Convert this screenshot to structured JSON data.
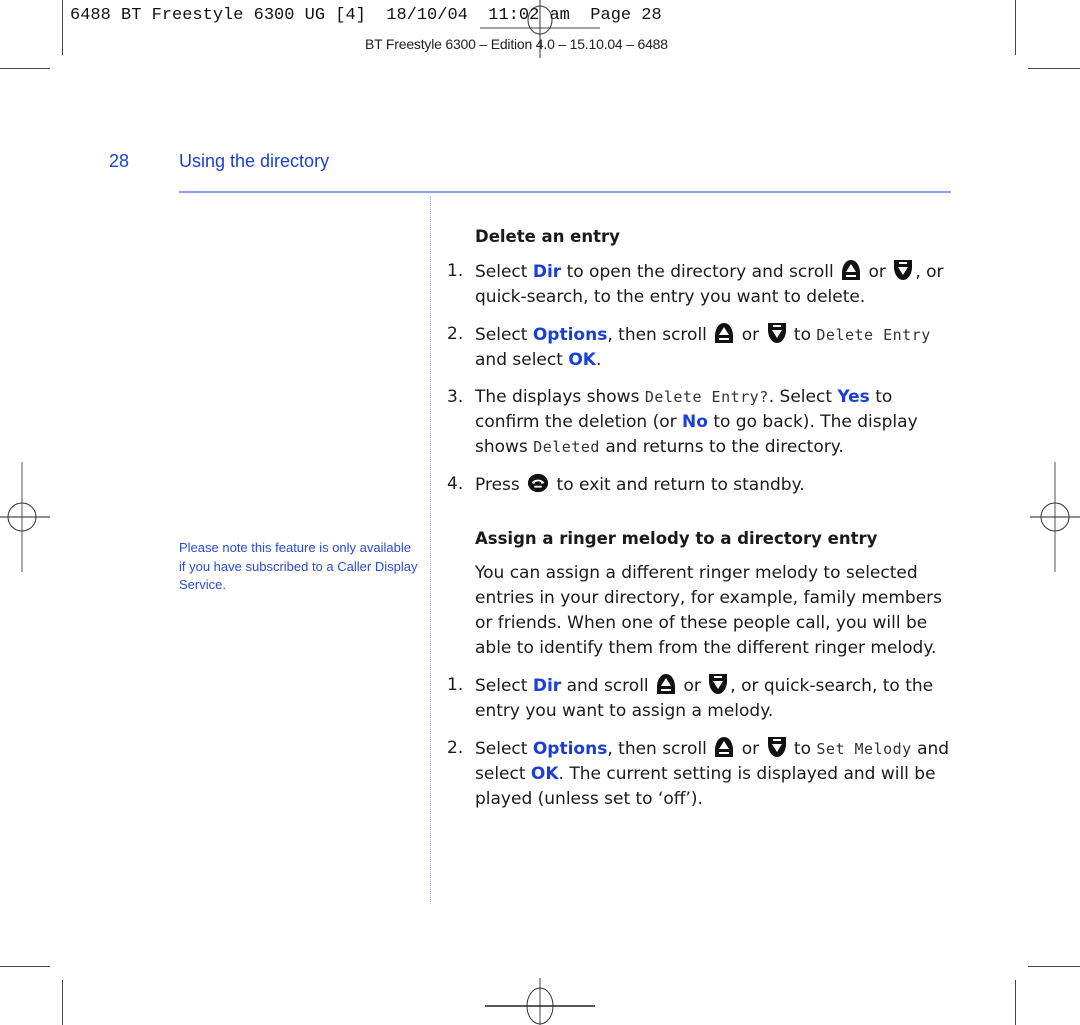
{
  "print_slug": {
    "text": "6488 BT Freestyle 6300 UG [4]  18/10/04  11:02 am  Page 28",
    "edition": "BT Freestyle 6300 – Edition 4.0 – 15.10.04 – 6488"
  },
  "header": {
    "page_number": "28",
    "section_title": "Using the directory"
  },
  "sidebar_note": "Please note this feature is only available if you have subscribed to a Caller Display Service.",
  "icons": {
    "up": "redial-up-key-icon",
    "down": "calls-down-key-icon",
    "end": "end-call-key-icon"
  },
  "delete_section": {
    "heading": "Delete an entry",
    "steps": [
      {
        "num": "1.",
        "t1": "Select ",
        "k1": "Dir",
        "t2": " to open the directory and scroll ",
        "or": " or ",
        "t3": ", or quick-search, to the entry you want to delete."
      },
      {
        "num": "2.",
        "t1": "Select ",
        "k1": "Options",
        "t2": ", then scroll ",
        "or": " or ",
        "t3": " to ",
        "lcd": "Delete Entry",
        "t4": " and select ",
        "k2": "OK",
        "t5": "."
      },
      {
        "num": "3.",
        "t1": "The displays shows ",
        "lcd1": "Delete Entry?",
        "t2": ". Select ",
        "k1": "Yes",
        "t3": " to confirm the deletion (or ",
        "k2": "No",
        "t4": " to go back). The display shows ",
        "lcd2": "Deleted",
        "t5": " and returns to the directory."
      },
      {
        "num": "4.",
        "t1": "Press ",
        "t2": " to exit and return to standby."
      }
    ]
  },
  "melody_section": {
    "heading": "Assign a ringer melody to a directory entry",
    "intro": "You can assign a different ringer melody to selected entries in your directory, for example, family members or friends. When one of these people call, you will be able to identify them from the different ringer melody.",
    "steps": [
      {
        "num": "1.",
        "t1": "Select ",
        "k1": "Dir",
        "t2": " and scroll ",
        "or": " or ",
        "t3": ", or quick-search, to the entry you want to assign a melody."
      },
      {
        "num": "2.",
        "t1": "Select ",
        "k1": "Options",
        "t2": ", then scroll ",
        "or": " or ",
        "t3": " to ",
        "lcd": "Set Melody",
        "t4": " and select ",
        "k2": "OK",
        "t5": ". The current setting is displayed and will be played (unless set to ‘off’)."
      }
    ]
  }
}
